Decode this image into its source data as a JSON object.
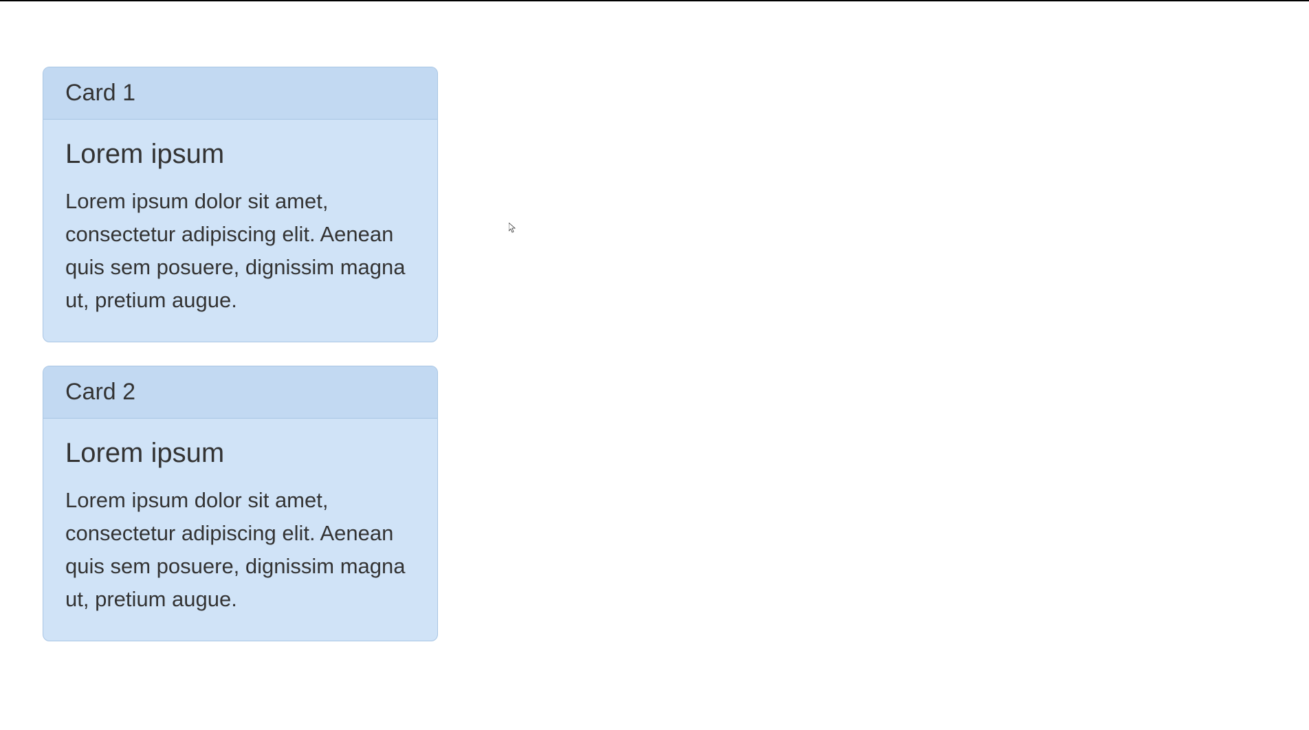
{
  "cards": [
    {
      "header": "Card 1",
      "title": "Lorem ipsum",
      "text": "Lorem ipsum dolor sit amet, consectetur adipiscing elit. Aenean quis sem posuere, dignissim magna ut, pretium augue."
    },
    {
      "header": "Card 2",
      "title": "Lorem ipsum",
      "text": "Lorem ipsum dolor sit amet, consectetur adipiscing elit. Aenean quis sem posuere, dignissim magna ut, pretium augue."
    }
  ]
}
